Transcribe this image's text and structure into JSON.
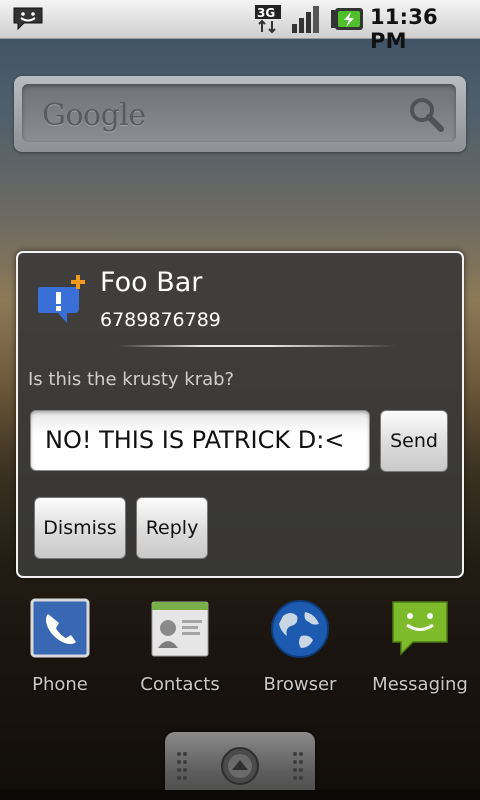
{
  "status_bar": {
    "time": "11:36 PM",
    "network_label": "3G",
    "icons": [
      "message-notification-icon",
      "network-3g-icon",
      "signal-icon",
      "battery-charging-icon"
    ]
  },
  "search_widget": {
    "logo_text": "Google",
    "icon": "search-icon"
  },
  "notification_dialog": {
    "sender_name": "Foo Bar",
    "sender_number": "6789876789",
    "message": "Is this the krusty krab?",
    "reply_value": "NO! THIS IS PATRICK D:<",
    "send_label": "Send",
    "dismiss_label": "Dismiss",
    "reply_label": "Reply",
    "icon": "add-message-icon"
  },
  "dock": {
    "items": [
      {
        "label": "Phone",
        "icon": "phone-icon"
      },
      {
        "label": "Contacts",
        "icon": "contacts-icon"
      },
      {
        "label": "Browser",
        "icon": "globe-icon"
      },
      {
        "label": "Messaging",
        "icon": "messaging-icon"
      }
    ]
  },
  "colors": {
    "dialog_bg": "#3a3a3a",
    "accent_orange": "#f39a1e",
    "message_blue": "#3b6fd8",
    "messaging_green": "#7dbb2a"
  }
}
